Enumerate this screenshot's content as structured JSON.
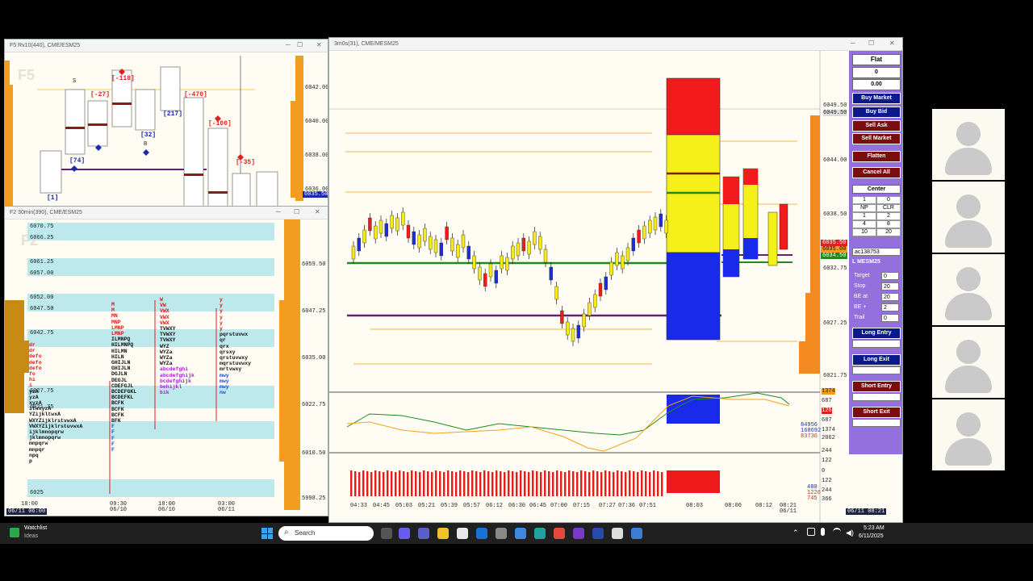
{
  "window_f5": {
    "title": "F5 Rv10(440), CME/ESM25",
    "watermark": "F5",
    "prices": [
      "6042.00",
      "6040.00",
      "6038.00",
      "6036.00"
    ],
    "last_price": "6035.50",
    "delta_labels": [
      "[1]",
      "[74]",
      "[-27]",
      "[-118]",
      "[32]",
      "[217]",
      "[-470]",
      "[-100]",
      "[-35]"
    ],
    "letters": [
      "S",
      "B"
    ]
  },
  "window_f2": {
    "title": "F2 30min(390), CME/ESM25",
    "watermark": "F2",
    "level_labels": [
      "6070.75",
      "6066.25",
      "6061.25",
      "6057.00",
      "6052.00",
      "6047.50",
      "6042.75",
      "6027.75",
      "6021.75",
      "6025"
    ],
    "prices": [
      "6059.50",
      "6047.25",
      "6035.00",
      "6022.75",
      "6010.50",
      "5998.25"
    ],
    "time_labels": [
      {
        "t": "18:00",
        "d": "06/11 06:00"
      },
      {
        "t": "09:30",
        "d": "06/10"
      },
      {
        "t": "18:00",
        "d": "06/10"
      },
      {
        "t": "03:00",
        "d": "06/11"
      }
    ],
    "tpo_rows": [
      "M",
      "M",
      "MN",
      "MNP",
      "LMNP",
      "LMNP",
      "ILMNPQ",
      "HILMNPQ",
      "HILMN",
      "HILN",
      "GHIJLN",
      "GHIJLN",
      "DGJLN",
      "DEGJL",
      "CDEFGJL",
      "BCDEFGKL",
      "BCDEFKL",
      "BCFK",
      "BCFK",
      "BCFK",
      "BFK",
      "F",
      "F",
      "F",
      "F",
      "F"
    ],
    "tpo_col2": [
      "W",
      "VW",
      "VWX",
      "VWX",
      "VWX",
      "TVWXY",
      "TVWXY",
      "TVWXY",
      "WYZ",
      "WYZa",
      "WYZa",
      "WYZa",
      "abcdefghi",
      "abcdefghijk",
      "bcdefghijk",
      "behijkl",
      "bik"
    ],
    "tpo_col3": [
      "y",
      "y",
      "y",
      "y",
      "y",
      "y",
      "pqrstuvwx",
      "qr",
      "qrx",
      "qrsxy",
      "qrstuvwxy",
      "mqrstuvwxy",
      "mrtvwxy",
      "mwy",
      "mwy",
      "mwy",
      "nw"
    ],
    "tpo_left": [
      "dr",
      "dr",
      "defo",
      "defo",
      "defo",
      "fo",
      "hi",
      "i",
      "yzA",
      "yzA",
      "xyzA",
      "itwxyzA",
      "YZijkltwxA",
      "WXYZijklrstvwxA",
      "VWXYZijklrstuvwxA",
      "ijklmnopqrw",
      "jklmnopqrw",
      "mnpqrw",
      "mnpqr",
      "npq",
      "p"
    ]
  },
  "window_main": {
    "title": "3m0s(31), CME/MESM25",
    "prices": [
      "6049.50",
      "6044.00",
      "6038.50",
      "6032.75",
      "6027.25",
      "6021.75"
    ],
    "top_price": "6049.50",
    "current_prices": [
      "6035.50",
      "6035.00",
      "6034.50"
    ],
    "time_labels": [
      "04:33",
      "04:45",
      "05:03",
      "05:21",
      "05:39",
      "05:57",
      "06:12",
      "06:30",
      "06:45",
      "07:00",
      "07:15",
      "07:27",
      "07:36",
      "07:51",
      "08:03",
      "08:06",
      "08:12",
      "08:21"
    ],
    "date_label": "06/11",
    "letters": [
      "S",
      "B"
    ],
    "indicator1_labels": [
      "1374",
      "687",
      "126",
      "687",
      "1374",
      "2062"
    ],
    "indicator1_values": [
      "84956",
      "168692",
      "83736"
    ],
    "indicator2_labels": [
      "244",
      "122",
      "0",
      "122",
      "244",
      "366"
    ],
    "indicator2_values": [
      "480",
      "1226",
      "745"
    ]
  },
  "panel": {
    "status": "Flat",
    "position": "0",
    "pnl": "0.00",
    "buy_market": "Buy Market",
    "buy_bid": "Buy Bid",
    "sell_ask": "Sell Ask",
    "sell_market": "Sell Market",
    "flatten": "Flatten",
    "cancel_all": "Cancel All",
    "center": "Center",
    "qty": "1",
    "qty_right": "0",
    "np_label": "NP",
    "clr_label": "CLR",
    "grid": [
      [
        "1",
        "2"
      ],
      [
        "4",
        "8"
      ],
      [
        "10",
        "20"
      ]
    ],
    "account": "ac138753",
    "symbol": "L MESM25",
    "target_label": "Target",
    "target_value": "0",
    "stop_label": "Stop",
    "stop_value": "20",
    "beat_label": "BE at",
    "beat_value": "20",
    "beplus_label": "BE +",
    "beplus_value": "2",
    "trail_label": "Trail",
    "trail_value": "0",
    "long_entry": "Long Entry",
    "long_exit": "Long Exit",
    "short_entry": "Short Entry",
    "short_exit": "Short Exit",
    "date_footer": "06/11 08:21"
  },
  "taskbar": {
    "widget_title": "Watchlist",
    "widget_subtitle": "Ideas",
    "search_placeholder": "Search",
    "time": "5:23 AM",
    "date": "6/11/2025"
  },
  "colors": {
    "panel_bg": "#9370db",
    "buy_blue": "#0a1a8a",
    "sell_red": "#7a0d0d",
    "cyan_band": "#bde9ec",
    "profile_orange": "#f29d1f",
    "chart_bg": "#fffdf3"
  }
}
